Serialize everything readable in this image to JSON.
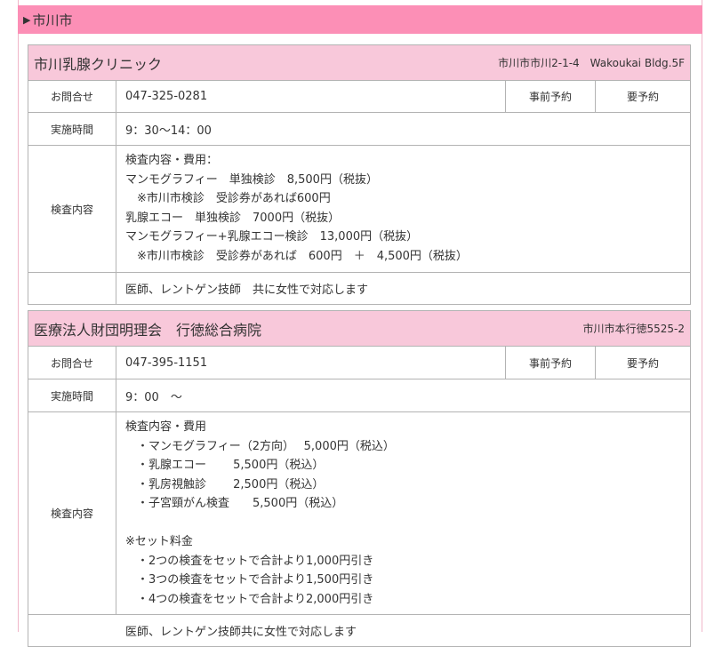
{
  "city_header": {
    "title": "市川市"
  },
  "clinics": [
    {
      "name": "市川乳腺クリニック",
      "address": "市川市市川2-1-4　Wakoukai Bldg.5F",
      "contact_label": "お問合せ",
      "phone": "047-325-0281",
      "reservation_label": "事前予約",
      "reservation_value": "要予約",
      "hours_label": "実施時間",
      "hours": "9：30～14：00",
      "content_label": "検査内容",
      "content_lines": [
        "検査内容・費用：",
        "マンモグラフィー　単独検診　8,500円（税抜）",
        "　※市川市検診　受診券があれば600円",
        "乳腺エコー　単独検診　7000円（税抜）",
        "マンモグラフィー+乳腺エコー検診　13,000円（税抜）",
        "　※市川市検診　受診券があれば　600円　＋　4,500円（税抜）"
      ],
      "note": "医師、レントゲン技師　共に女性で対応します"
    },
    {
      "name": "医療法人財団明理会　行徳総合病院",
      "address": "市川市本行徳5525-2",
      "contact_label": "お問合せ",
      "phone": "047-395-1151",
      "reservation_label": "事前予約",
      "reservation_value": "要予約",
      "hours_label": "実施時間",
      "hours": "9：00　～",
      "content_label": "検査内容",
      "content_lines": [
        "検査内容・費用",
        "　・マンモグラフィー（2方向）　 5,000円（税込）",
        "　・乳腺エコー　　 5,500円（税込）",
        "　・乳房視触診　　 2,500円（税込）",
        "　・子宮頸がん検査　　5,500円（税込）",
        "",
        "※セット料金",
        "　・2つの検査をセットで合計より1,000円引き",
        "　・3つの検査をセットで合計より1,500円引き",
        "　・4つの検査をセットで合計より2,000円引き"
      ],
      "note": "医師、レントゲン技師共に女性で対応します"
    }
  ]
}
